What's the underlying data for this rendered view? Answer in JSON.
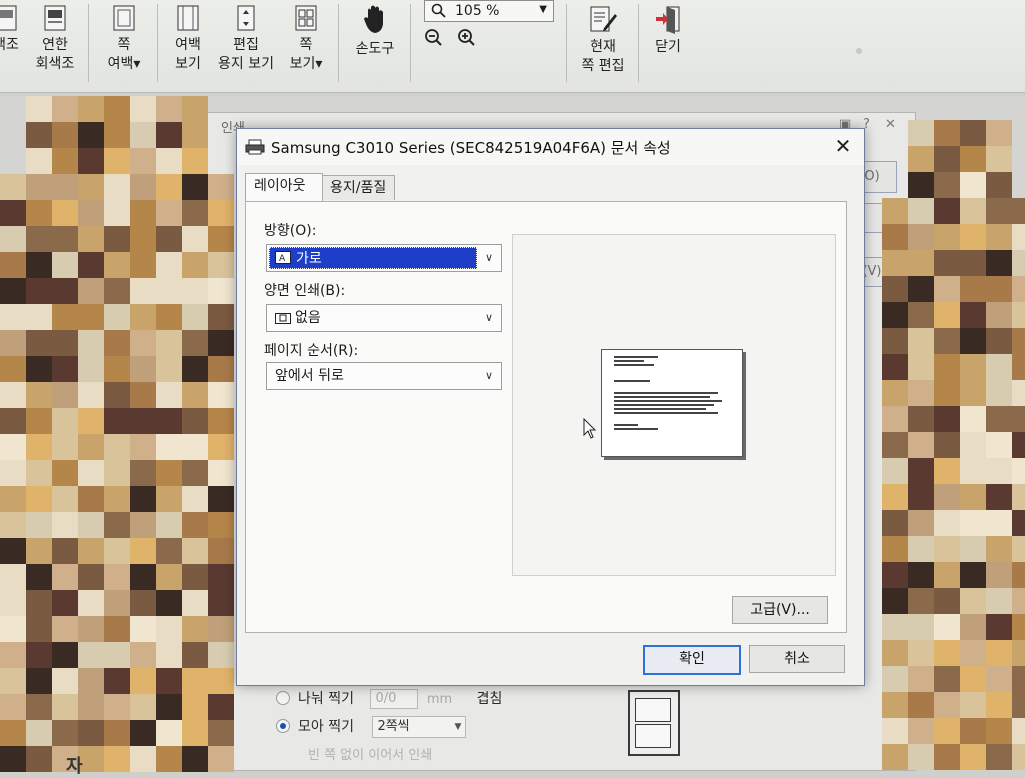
{
  "ribbon": {
    "items": [
      {
        "label1": "색조",
        "label2": "",
        "icon": "color-tone-icon"
      },
      {
        "label1": "연한",
        "label2": "회색조",
        "icon": "grayscale-icon"
      },
      {
        "label1": "쪽",
        "label2": "여백▾",
        "icon": "page-margin-icon"
      },
      {
        "label1": "여백",
        "label2": "보기",
        "icon": "margin-view-icon"
      },
      {
        "label1": "편집",
        "label2": "용지 보기",
        "icon": "edit-paper-icon"
      },
      {
        "label1": "쪽",
        "label2": "보기▾",
        "icon": "page-view-icon"
      },
      {
        "label1": "손도구",
        "label2": "",
        "icon": "hand-tool-icon"
      },
      {
        "label1": "현재",
        "label2": "쪽 편집",
        "icon": "edit-page-icon"
      },
      {
        "label1": "닫기",
        "label2": "",
        "icon": "exit-icon"
      }
    ],
    "zoom_value": "105 %"
  },
  "print_window": {
    "title": "인쇄",
    "bg_button_1": "O)",
    "bg_button_2": "(V)",
    "split_print_label": "나눠 찍기",
    "split_placeholder": "0/0",
    "unit_mm": "mm",
    "gutter_label": "겹침",
    "group_print_label": "모아 찍기",
    "group_print_value": "2쪽씩",
    "faded_option": "빈 쪽 없이 이어서 인쇄",
    "bottom_text": "자"
  },
  "dialog": {
    "title": "Samsung C3010 Series (SEC842519A04F6A) 문서 속성",
    "tabs": [
      "레이아웃",
      "용지/품질"
    ],
    "orientation_label": "방향(O):",
    "orientation_value": "가로",
    "duplex_label": "양면 인쇄(B):",
    "duplex_value": "없음",
    "page_order_label": "페이지 순서(R):",
    "page_order_value": "앞에서 뒤로",
    "advanced_button": "고급(V)...",
    "ok_button": "확인",
    "cancel_button": "취소"
  },
  "colors": {
    "selection": "#1d3ec9",
    "dialog_bg": "#f1f1ef",
    "focus_border": "#2f6fd8"
  }
}
